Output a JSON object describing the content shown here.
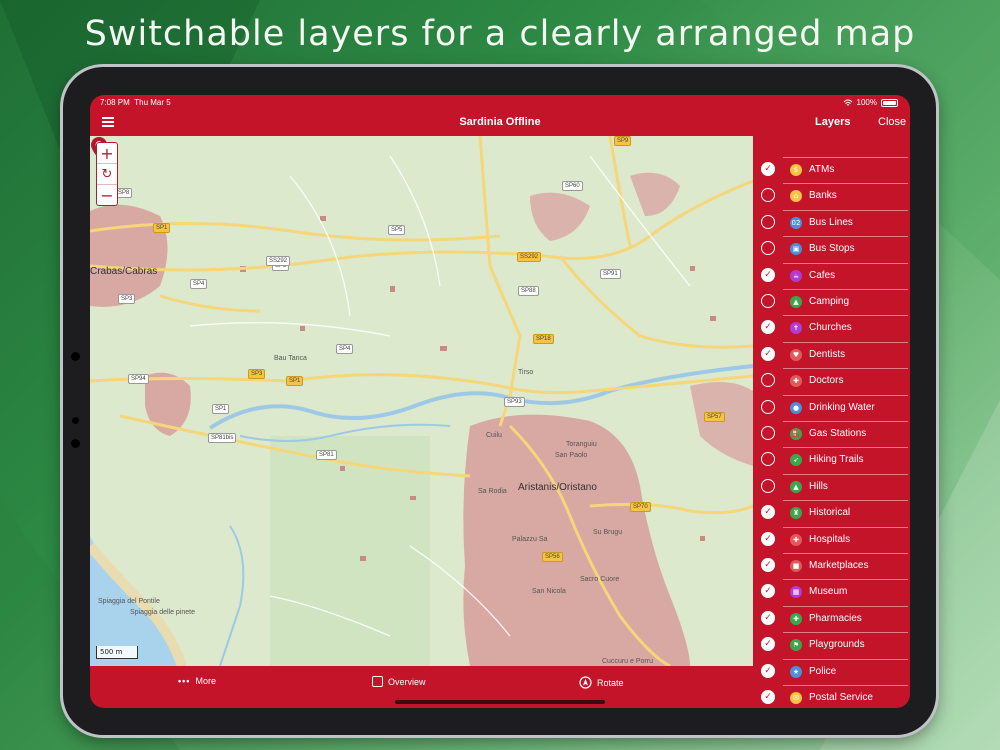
{
  "headline": "Switchable layers for a clearly arranged map",
  "status_bar": {
    "time": "7:08 PM",
    "date": "Thu Mar 5",
    "battery": "100%",
    "battery_level": 1.0,
    "wifi_icon": "wifi-icon"
  },
  "nav": {
    "menu_icon": "hamburger-icon",
    "title": "Sardinia Offline",
    "layers_title": "Layers",
    "close_label": "Close"
  },
  "map": {
    "zoom_in_icon": "+",
    "reset_icon": "↻",
    "zoom_out_icon": "−",
    "scale_label": "500 m",
    "places": {
      "cabras": "Crabas/Cabras",
      "oristano": "Aristanis/Oristano",
      "sa_rodia": "Sa Rodia",
      "san_paolo": "San Paolo",
      "torangiu": "Toranguiu",
      "cuilu": "Cuilu",
      "palazzu": "Palazzu Sa",
      "su_brugu": "Su Brugu",
      "sacro_cuore": "Sacro Cuore",
      "san_nicola": "San Nicola",
      "cuccuru": "Cuccuru e Porru",
      "spiaggia_pontile": "Spiaggia del Pontile",
      "spiaggia_pinete": "Spiaggia delle pinete",
      "tirso": "Tirso",
      "bau_tanca": "Bau Tanca"
    },
    "road_labels": {
      "sp1a": "SP1",
      "sp8": "SP8",
      "sp3": "SP3",
      "sp4a": "SP4",
      "sp5a": "SP5",
      "sp5b": "SP5",
      "ss292a": "SS292",
      "ss292b": "SS292",
      "sp9": "SP9",
      "sp60": "SP60",
      "sp91": "SP91",
      "sp88": "SP88",
      "sp18": "SP18",
      "sp4b": "SP4",
      "sp94": "SP94",
      "sp3b": "SP3",
      "sp1b": "SP1",
      "sp1c": "SP1",
      "sp93": "SP93",
      "sp57": "SP57",
      "sp81bis": "SP81bis",
      "sp81": "SP81",
      "sp70": "SP70",
      "sp56": "SP56"
    }
  },
  "toolbar": {
    "more_icon": "ellipsis-icon",
    "more_label": "More",
    "overview_icon": "square-icon",
    "overview_label": "Overview",
    "rotate_icon": "compass-icon",
    "rotate_label": "Rotate"
  },
  "layers": [
    {
      "label": "ATMs",
      "checked": true,
      "icon": "atm-icon",
      "glyph": "$",
      "color": "#f6c343"
    },
    {
      "label": "Banks",
      "checked": false,
      "icon": "bank-icon",
      "glyph": "⌂",
      "color": "#f6c343"
    },
    {
      "label": "Bus Lines",
      "checked": false,
      "icon": "bus-line-icon",
      "glyph": "02",
      "color": "#4a90d9"
    },
    {
      "label": "Bus Stops",
      "checked": false,
      "icon": "bus-stop-icon",
      "glyph": "▣",
      "color": "#4a90d9"
    },
    {
      "label": "Cafes",
      "checked": true,
      "icon": "cafe-icon",
      "glyph": "☕",
      "color": "#b23bd1"
    },
    {
      "label": "Camping",
      "checked": false,
      "icon": "camping-icon",
      "glyph": "▲",
      "color": "#3aa84a"
    },
    {
      "label": "Churches",
      "checked": true,
      "icon": "church-icon",
      "glyph": "✝",
      "color": "#b23bd1"
    },
    {
      "label": "Dentists",
      "checked": true,
      "icon": "dentist-icon",
      "glyph": "♥",
      "color": "#e05a5a"
    },
    {
      "label": "Doctors",
      "checked": false,
      "icon": "doctor-icon",
      "glyph": "✚",
      "color": "#e05a5a"
    },
    {
      "label": "Drinking Water",
      "checked": false,
      "icon": "water-drop-icon",
      "glyph": "●",
      "color": "#4a90d9"
    },
    {
      "label": "Gas Stations",
      "checked": false,
      "icon": "gas-station-icon",
      "glyph": "⛽",
      "color": "#3aa84a"
    },
    {
      "label": "Hiking Trails",
      "checked": false,
      "icon": "hiking-icon",
      "glyph": "➶",
      "color": "#3aa84a"
    },
    {
      "label": "Hills",
      "checked": false,
      "icon": "hill-icon",
      "glyph": "▲",
      "color": "#3aa84a"
    },
    {
      "label": "Historical",
      "checked": true,
      "icon": "historical-icon",
      "glyph": "♜",
      "color": "#3aa84a"
    },
    {
      "label": "Hospitals",
      "checked": true,
      "icon": "hospital-icon",
      "glyph": "✚",
      "color": "#e05a5a"
    },
    {
      "label": "Marketplaces",
      "checked": true,
      "icon": "marketplace-icon",
      "glyph": "■",
      "color": "#e05a5a"
    },
    {
      "label": "Museum",
      "checked": true,
      "icon": "museum-icon",
      "glyph": "▦",
      "color": "#b23bd1"
    },
    {
      "label": "Pharmacies",
      "checked": true,
      "icon": "pharmacy-icon",
      "glyph": "✚",
      "color": "#3aa84a"
    },
    {
      "label": "Playgrounds",
      "checked": true,
      "icon": "playground-icon",
      "glyph": "⚑",
      "color": "#3aa84a"
    },
    {
      "label": "Police",
      "checked": true,
      "icon": "police-icon",
      "glyph": "★",
      "color": "#4a90d9"
    },
    {
      "label": "Postal Service",
      "checked": true,
      "icon": "postal-icon",
      "glyph": "✉",
      "color": "#f6c343"
    }
  ]
}
